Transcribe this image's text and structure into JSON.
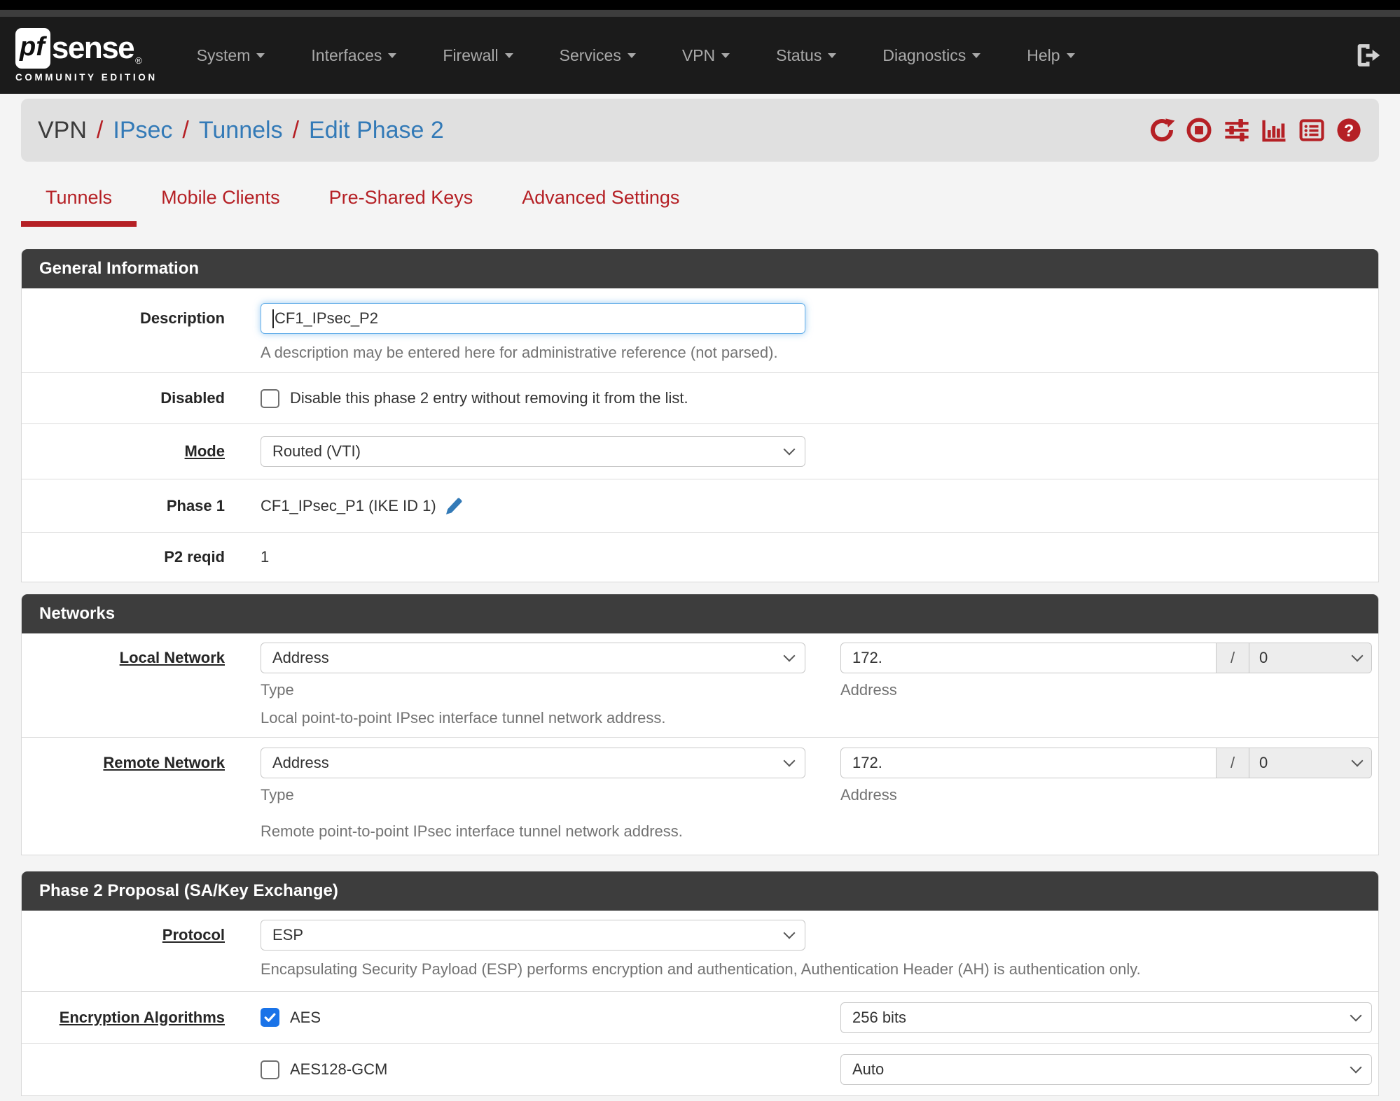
{
  "colors": {
    "accent_red": "#b52025",
    "link_blue": "#337ab7",
    "panel_header_bg": "#3d3d3d",
    "checkbox_blue": "#1a73e8",
    "navbar_bg": "#1b1b1b"
  },
  "navbar": {
    "brand_pf": "pf",
    "brand_sense": "sense",
    "brand_reg": "®",
    "brand_subtitle": "COMMUNITY EDITION",
    "items": [
      {
        "label": "System"
      },
      {
        "label": "Interfaces"
      },
      {
        "label": "Firewall"
      },
      {
        "label": "Services"
      },
      {
        "label": "VPN"
      },
      {
        "label": "Status"
      },
      {
        "label": "Diagnostics"
      },
      {
        "label": "Help"
      }
    ]
  },
  "breadcrumb": {
    "section": "VPN",
    "sep": "/",
    "crumb1": "IPsec",
    "crumb2": "Tunnels",
    "crumb3": "Edit Phase 2"
  },
  "tabs": [
    {
      "label": "Tunnels",
      "active": true
    },
    {
      "label": "Mobile Clients",
      "active": false
    },
    {
      "label": "Pre-Shared Keys",
      "active": false
    },
    {
      "label": "Advanced Settings",
      "active": false
    }
  ],
  "general": {
    "title": "General Information",
    "description_label": "Description",
    "description_value": "CF1_IPsec_P2",
    "description_help": "A description may be entered here for administrative reference (not parsed).",
    "disabled_label": "Disabled",
    "disabled_text": "Disable this phase 2 entry without removing it from the list.",
    "disabled_checked": false,
    "mode_label": "Mode",
    "mode_value": "Routed (VTI)",
    "phase1_label": "Phase 1",
    "phase1_value": "CF1_IPsec_P1 (IKE ID 1)",
    "p2reqid_label": "P2 reqid",
    "p2reqid_value": "1"
  },
  "networks": {
    "title": "Networks",
    "local_label": "Local Network",
    "remote_label": "Remote Network",
    "type_value": "Address",
    "type_caption": "Type",
    "address_value": "172.",
    "address_caption": "Address",
    "slash": "/",
    "mask_value": "0",
    "local_help": "Local point-to-point IPsec interface tunnel network address.",
    "remote_help": "Remote point-to-point IPsec interface tunnel network address."
  },
  "proposal": {
    "title": "Phase 2 Proposal (SA/Key Exchange)",
    "protocol_label": "Protocol",
    "protocol_value": "ESP",
    "protocol_help": "Encapsulating Security Payload (ESP) performs encryption and authentication, Authentication Header (AH) is authentication only.",
    "enc_label": "Encryption Algorithms",
    "enc1_name": "AES",
    "enc1_checked": true,
    "enc1_keylen": "256 bits",
    "enc2_name": "AES128-GCM",
    "enc2_checked": false,
    "enc2_keylen": "Auto"
  }
}
